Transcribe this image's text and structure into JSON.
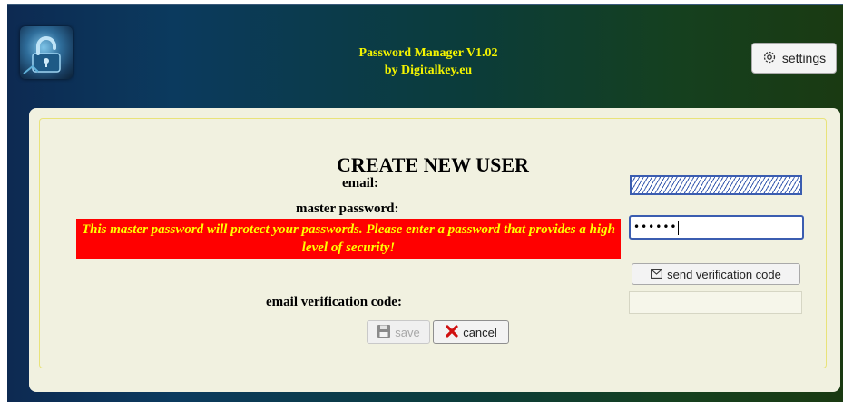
{
  "header": {
    "title_line1": "Password Manager V1.02",
    "title_line2": "by Digitalkey.eu",
    "logo_icon": "lock-icon",
    "settings_label": "settings",
    "settings_icon": "gear-icon"
  },
  "form": {
    "heading": "CREATE NEW USER",
    "email_label": "email:",
    "email_value": "",
    "master_password_label": "master password:",
    "master_password_value": "••••••",
    "warning": "This master password will protect your passwords. Please enter a password that provides a high level of security!",
    "send_code_label": "send verification code",
    "send_code_icon": "envelope-icon",
    "verification_label": "email verification code:",
    "verification_value": "",
    "save_label": "save",
    "save_icon": "floppy-disk-icon",
    "save_enabled": false,
    "cancel_label": "cancel",
    "cancel_icon": "close-icon"
  },
  "colors": {
    "title": "#f4f400",
    "warning_bg": "#ff0000",
    "warning_text": "#ffff00",
    "panel_bg": "#f1f1e0",
    "input_border": "#3b5db0"
  }
}
